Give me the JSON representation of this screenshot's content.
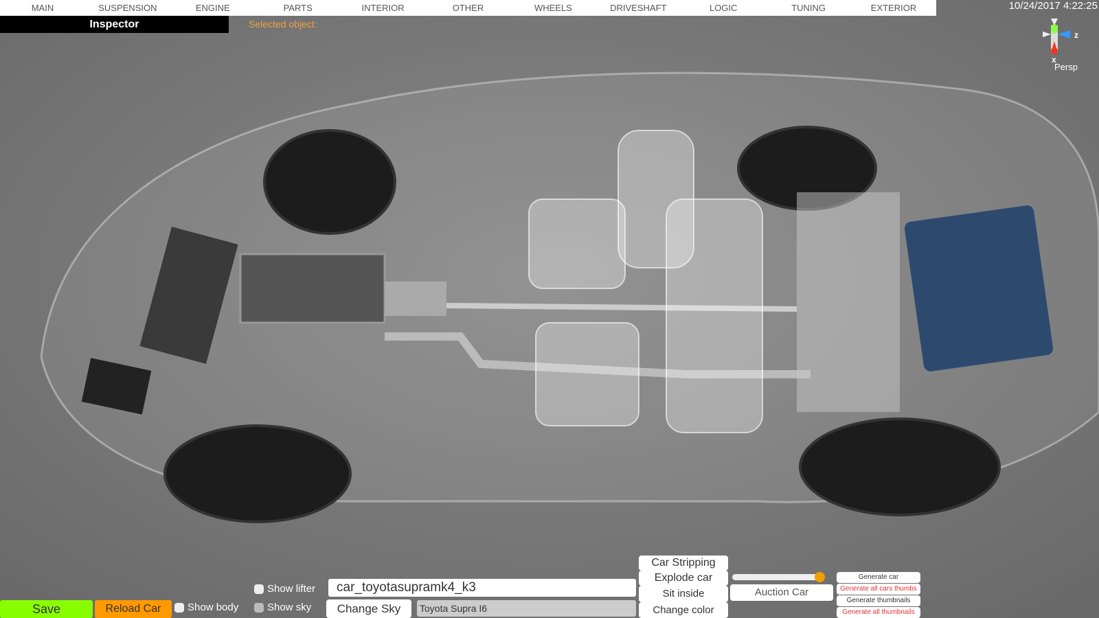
{
  "nav": {
    "tabs": [
      "MAIN",
      "SUSPENSION",
      "ENGINE",
      "PARTS",
      "INTERIOR",
      "OTHER",
      "WHEELS",
      "DRIVESHAFT",
      "LOGIC",
      "TUNING",
      "EXTERIOR"
    ]
  },
  "inspector": {
    "title": "Inspector",
    "selected_label": "Selected object:"
  },
  "clock": "10/24/2017 4:22:25",
  "gizmo": {
    "axis_z": "z",
    "axis_x": "x",
    "view": "Persp"
  },
  "bottom": {
    "save": "Save",
    "reload": "Reload Car",
    "show_body": "Show body",
    "show_lifter": "Show lifter",
    "show_sky": "Show sky",
    "car_id": "car_toyotasupramk4_k3",
    "change_sky": "Change Sky",
    "car_name": "Toyota Supra I6",
    "car_stripping": "Car Stripping",
    "explode_car": "Explode car",
    "sit_inside": "Sit inside",
    "change_color": "Change color",
    "auction_car": "Auction Car",
    "slider_value": 0.95,
    "generate_car": "Generate car",
    "generate_all_cars_thumbs": "Generate all cars thumbs",
    "generate_thumbnails": "Generate thumbnails",
    "generate_all_thumbnails": "Generate all thumbnails"
  }
}
